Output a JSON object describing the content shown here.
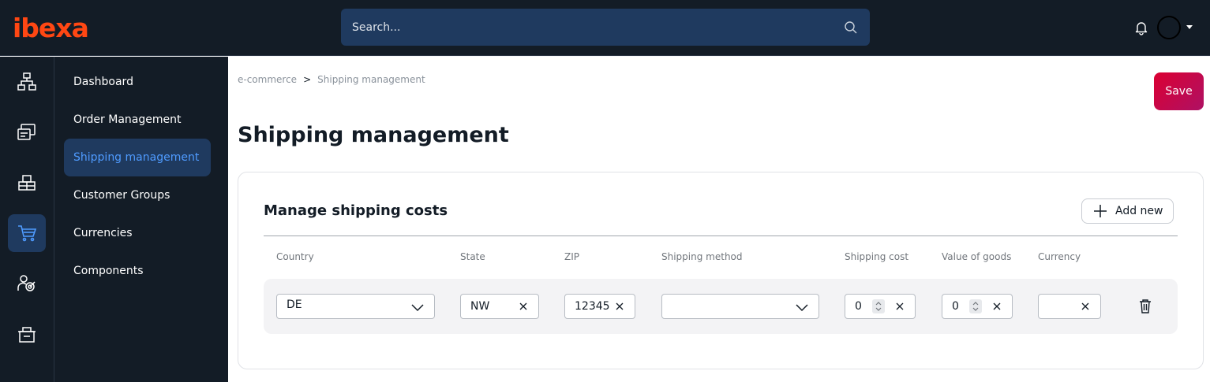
{
  "app": {
    "logo_text": "ibexa"
  },
  "search": {
    "placeholder": "Search..."
  },
  "rail": {
    "items": [
      "sitemap-icon",
      "content-icon",
      "products-icon",
      "cart-icon",
      "customer-icon",
      "store-icon"
    ],
    "active_index": 3
  },
  "subnav": {
    "items": [
      {
        "label": "Dashboard"
      },
      {
        "label": "Order Management"
      },
      {
        "label": "Shipping management",
        "active": true
      },
      {
        "label": "Customer Groups"
      },
      {
        "label": "Currencies"
      },
      {
        "label": "Components"
      }
    ]
  },
  "breadcrumb": {
    "items": [
      "e-commerce",
      "Shipping management"
    ],
    "separator": ">"
  },
  "header": {
    "title": "Shipping management",
    "save_label": "Save"
  },
  "card": {
    "title": "Manage shipping costs",
    "add_label": "Add new",
    "columns": [
      "Country",
      "State",
      "ZIP",
      "Shipping method",
      "Shipping cost",
      "Value of goods",
      "Currency"
    ],
    "row": {
      "country": "DE",
      "state": "NW",
      "zip": "12345",
      "shipping_method": "",
      "shipping_cost": "0",
      "value_of_goods": "0",
      "currency": ""
    }
  },
  "colors": {
    "topbar": "#131c26",
    "accent": "#4f9bff",
    "active_bg": "#1f3a5f",
    "save_gradient_start": "#db0032",
    "save_gradient_end": "#ae1164",
    "logo": "#ff4713"
  }
}
